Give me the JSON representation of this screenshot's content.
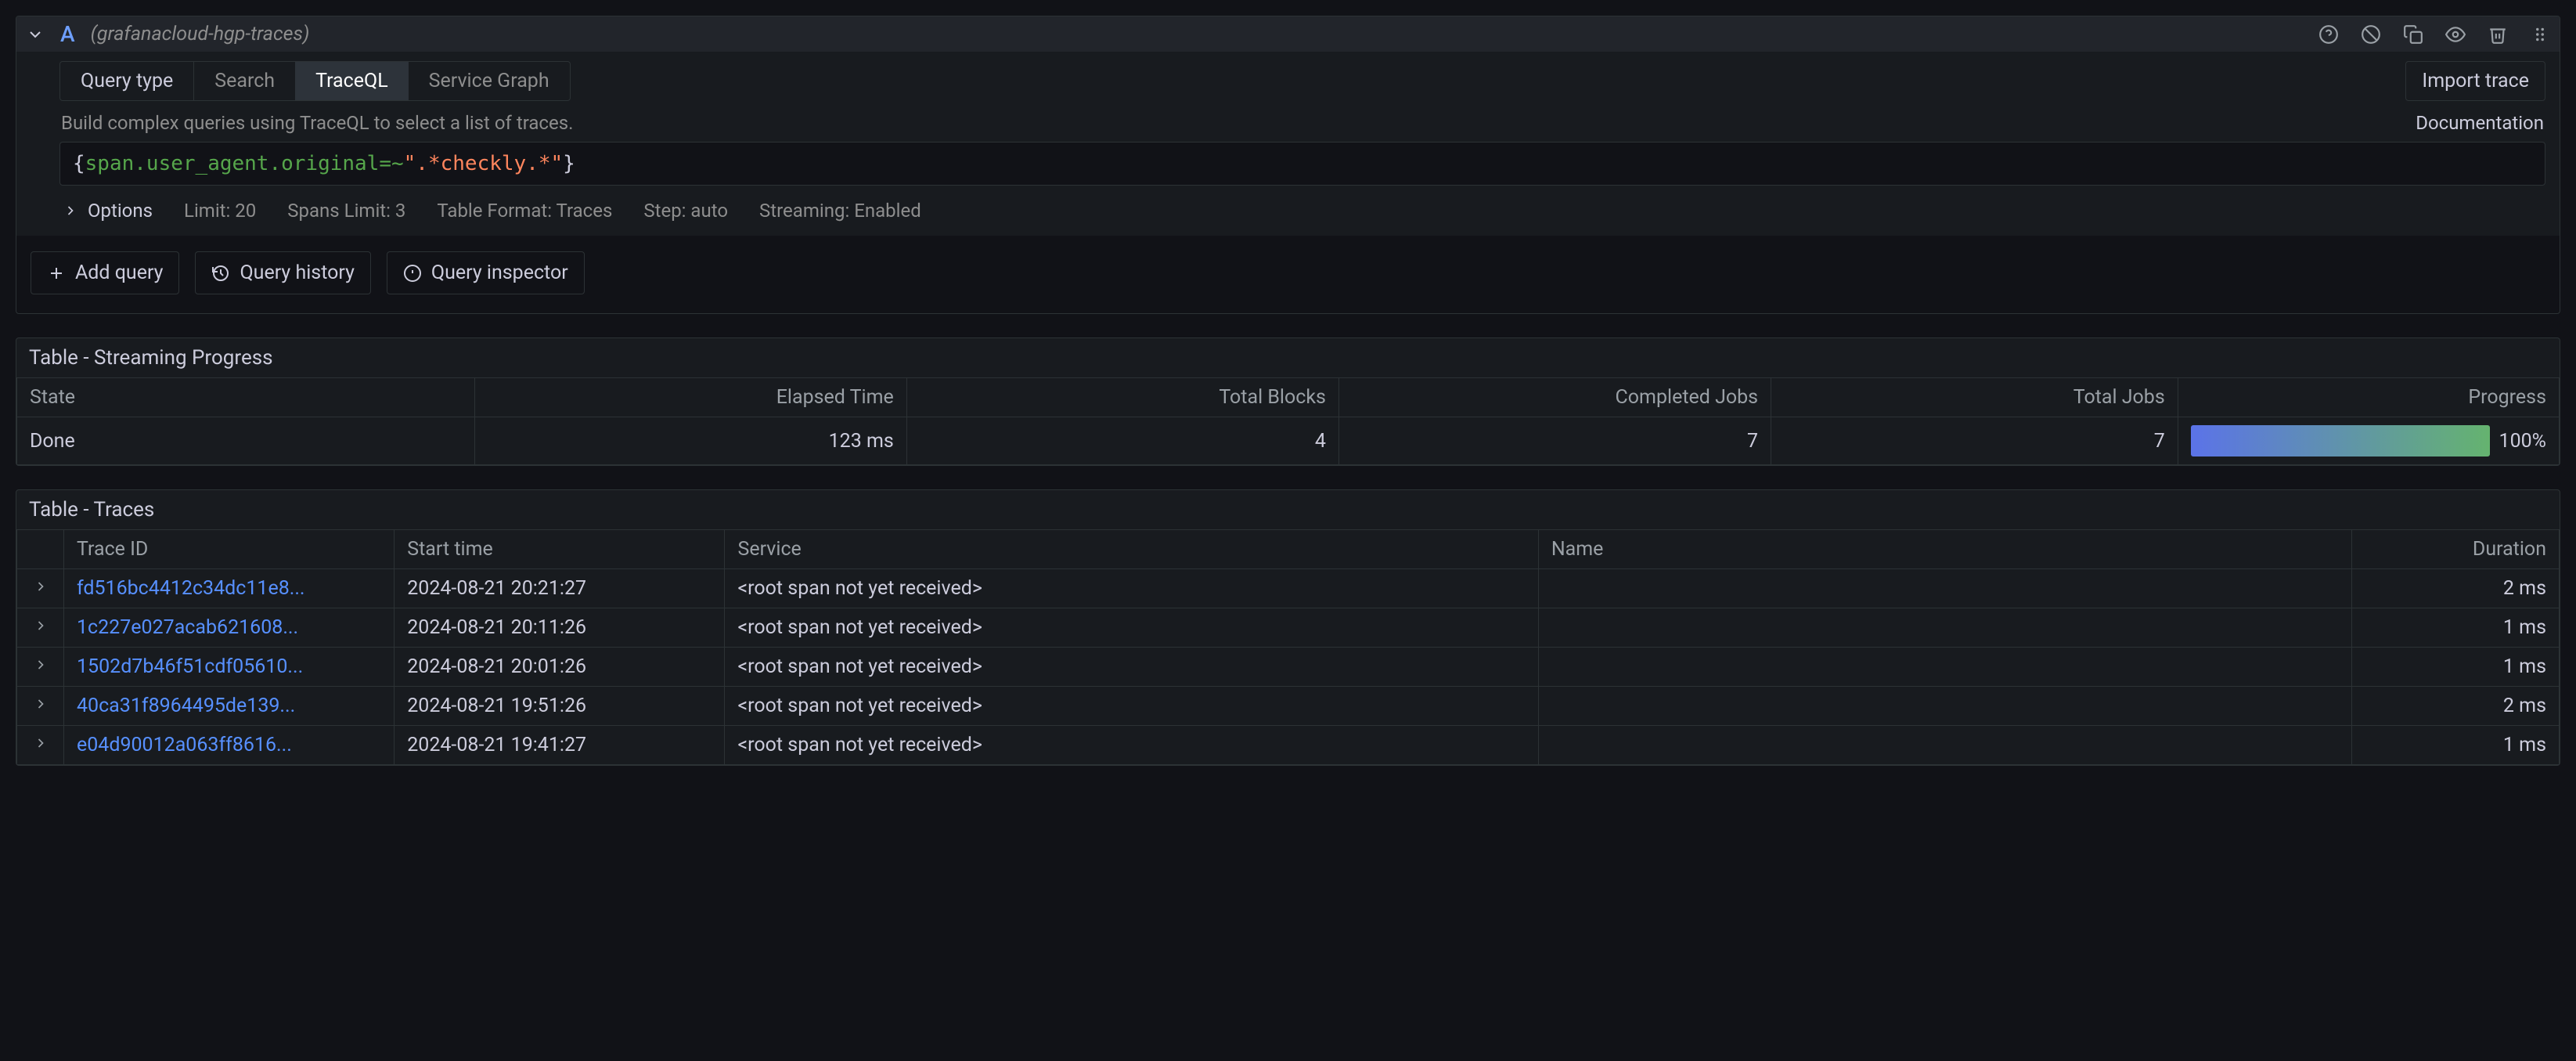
{
  "header": {
    "letter": "A",
    "datasource": "(grafanacloud-hgp-traces)"
  },
  "tabs": {
    "label": "Query type",
    "search": "Search",
    "traceql": "TraceQL",
    "service_graph": "Service Graph"
  },
  "import_label": "Import trace",
  "hint": "Build complex queries using TraceQL to select a list of traces.",
  "doc_label": "Documentation",
  "query": {
    "brace_open": "{",
    "key": "span.user_agent.original",
    "op": "=~",
    "str": "\".*checkly.*\"",
    "brace_close": "}"
  },
  "options": {
    "lead": "Options",
    "limit": "Limit: 20",
    "spans": "Spans Limit: 3",
    "table_format": "Table Format: Traces",
    "step": "Step: auto",
    "streaming": "Streaming: Enabled"
  },
  "buttons": {
    "add_query": "Add query",
    "query_history": "Query history",
    "query_inspector": "Query inspector"
  },
  "progress_table": {
    "title": "Table - Streaming Progress",
    "headers": {
      "state": "State",
      "elapsed": "Elapsed Time",
      "total_blocks": "Total Blocks",
      "completed_jobs": "Completed Jobs",
      "total_jobs": "Total Jobs",
      "progress": "Progress"
    },
    "row": {
      "state": "Done",
      "elapsed": "123 ms",
      "total_blocks": "4",
      "completed_jobs": "7",
      "total_jobs": "7",
      "progress": "100%"
    }
  },
  "traces_table": {
    "title": "Table - Traces",
    "headers": {
      "trace_id": "Trace ID",
      "start_time": "Start time",
      "service": "Service",
      "name": "Name",
      "duration": "Duration"
    },
    "rows": [
      {
        "trace_id": "fd516bc4412c34dc11e8...",
        "start_time": "2024-08-21 20:21:27",
        "service": "<root span not yet received>",
        "name": "",
        "duration": "2 ms"
      },
      {
        "trace_id": "1c227e027acab621608...",
        "start_time": "2024-08-21 20:11:26",
        "service": "<root span not yet received>",
        "name": "",
        "duration": "1 ms"
      },
      {
        "trace_id": "1502d7b46f51cdf05610...",
        "start_time": "2024-08-21 20:01:26",
        "service": "<root span not yet received>",
        "name": "",
        "duration": "1 ms"
      },
      {
        "trace_id": "40ca31f8964495de139...",
        "start_time": "2024-08-21 19:51:26",
        "service": "<root span not yet received>",
        "name": "",
        "duration": "2 ms"
      },
      {
        "trace_id": "e04d90012a063ff8616...",
        "start_time": "2024-08-21 19:41:27",
        "service": "<root span not yet received>",
        "name": "",
        "duration": "1 ms"
      }
    ]
  }
}
